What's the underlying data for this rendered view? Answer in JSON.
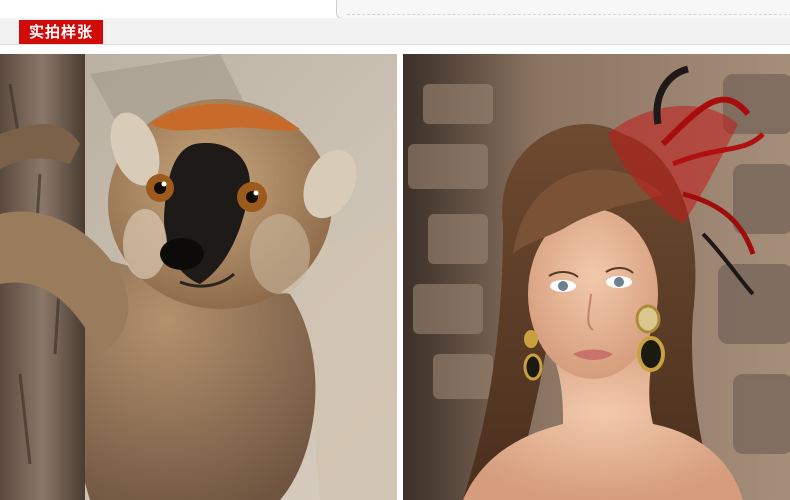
{
  "header": {
    "title": "实拍样张",
    "accent_color": "#d10a0a"
  },
  "gallery": {
    "photos": [
      {
        "icon": "lemur-photo"
      },
      {
        "icon": "woman-portrait-photo"
      }
    ]
  }
}
